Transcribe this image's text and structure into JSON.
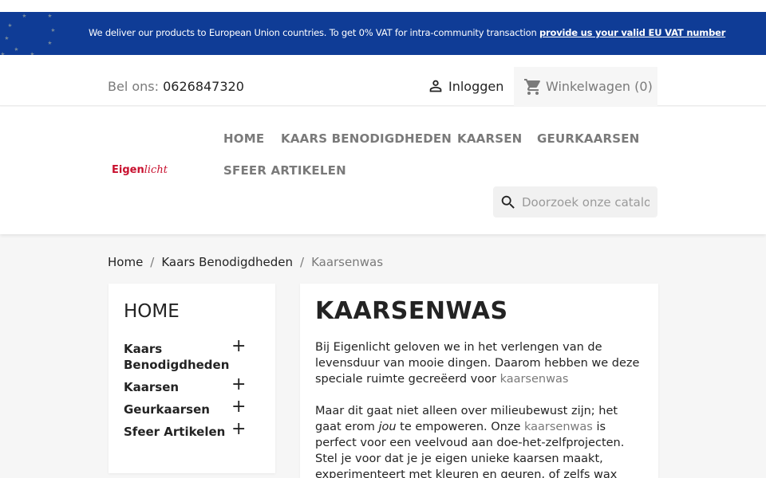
{
  "banner": {
    "message": "We deliver our products to European Union countries. To get 0% VAT for intra-community transaction ",
    "link_text": "provide us your valid EU VAT number"
  },
  "top_nav": {
    "phone_label": "Bel ons: ",
    "phone_number": "0626847320",
    "login_label": "Inloggen",
    "cart_label": "Winkelwagen (0)"
  },
  "header": {
    "logo_part1": "Eigen",
    "logo_part2": "licht",
    "menu": [
      "HOME",
      "KAARS BENODIGDHEDEN",
      "KAARSEN",
      "GEURKAARSEN",
      "SFEER ARTIKELEN"
    ],
    "search_placeholder": "Doorzoek onze catalogus"
  },
  "breadcrumb": {
    "items": [
      "Home",
      "Kaars Benodigdheden",
      "Kaarsenwas"
    ],
    "separator": "/"
  },
  "sidebar": {
    "title": "HOME",
    "items": [
      {
        "label": "Kaars Benodigdheden",
        "toggle": "+"
      },
      {
        "label": "Kaarsen",
        "toggle": "+"
      },
      {
        "label": "Geurkaarsen",
        "toggle": "+"
      },
      {
        "label": "Sfeer Artikelen",
        "toggle": "+"
      }
    ]
  },
  "content": {
    "title": "KAARSENWAS",
    "p1_text": "Bij Eigenlicht geloven we in het verlengen van de levensduur van mooie dingen. Daarom hebben we deze speciale ruimte gecreëerd voor ",
    "p1_link": "kaarsenwas",
    "p2_a": "Maar dit gaat niet alleen over milieubewust zijn; het gaat erom ",
    "p2_em": "jou",
    "p2_b": " te empoweren. Onze ",
    "p2_link": "kaarsenwas",
    "p2_c": " is perfect voor een veelvoud aan doe-het-zelfprojecten. Stel je voor dat je je eigen unieke kaarsen maakt, experimenteert met kleuren en geuren, of zelfs wax"
  },
  "colors": {
    "banner_bg": "#0f3c96",
    "brand_red": "#c8102e",
    "text_dark": "#232323",
    "text_muted": "#7a7a7a"
  }
}
